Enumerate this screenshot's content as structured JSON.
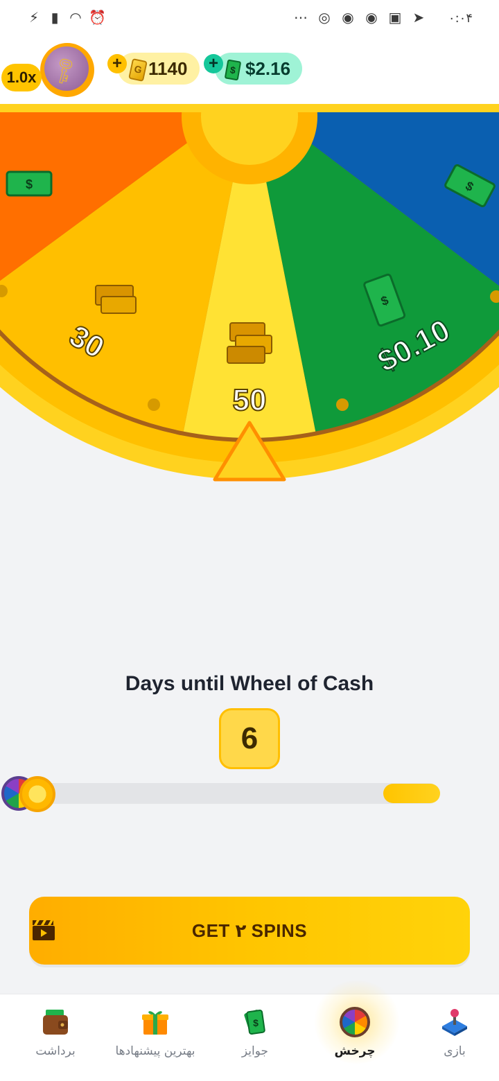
{
  "status_bar": {
    "time": "۰:۰۴",
    "left_icons": [
      "battery-charging-icon",
      "signal-icon",
      "wifi-icon",
      "alarm-icon"
    ],
    "right_icons": [
      "more-icon",
      "instagram-icon",
      "chrome-icon",
      "chrome-icon",
      "voicemail-icon",
      "telegram-icon"
    ]
  },
  "header": {
    "multiplier": "1.0x",
    "tickets": "1140",
    "cash": "$2.16"
  },
  "wheel": {
    "segments": [
      {
        "label": "",
        "color": "#ff6f00",
        "prize": "cash-icon"
      },
      {
        "label": "30",
        "color": "#ffbf00",
        "prize": "gold-bars-icon"
      },
      {
        "label": "50",
        "color": "#ffe234",
        "prize": "gold-bars-icon"
      },
      {
        "label": "$0.10",
        "color": "#0f9a3a",
        "prize": "cash-icon"
      },
      {
        "label": "",
        "color": "#0a5fb0",
        "prize": "cash-icon"
      }
    ]
  },
  "countdown": {
    "title": "Days until Wheel of Cash",
    "days": "6",
    "progress": 0.88
  },
  "cta": {
    "label": "GET ۲ SPINS"
  },
  "nav": [
    {
      "label": "بازی",
      "icon": "joystick-icon"
    },
    {
      "label": "چرخش",
      "icon": "wheel-icon",
      "active": true
    },
    {
      "label": "جوایز",
      "icon": "cash-stack-icon"
    },
    {
      "label": "بهترین پیشنهادها",
      "icon": "gift-icon"
    },
    {
      "label": "برداشت",
      "icon": "wallet-icon"
    }
  ],
  "colors": {
    "accent": "#ffc400",
    "cash_green": "#1fb44c",
    "text_dark": "#1f2430"
  }
}
